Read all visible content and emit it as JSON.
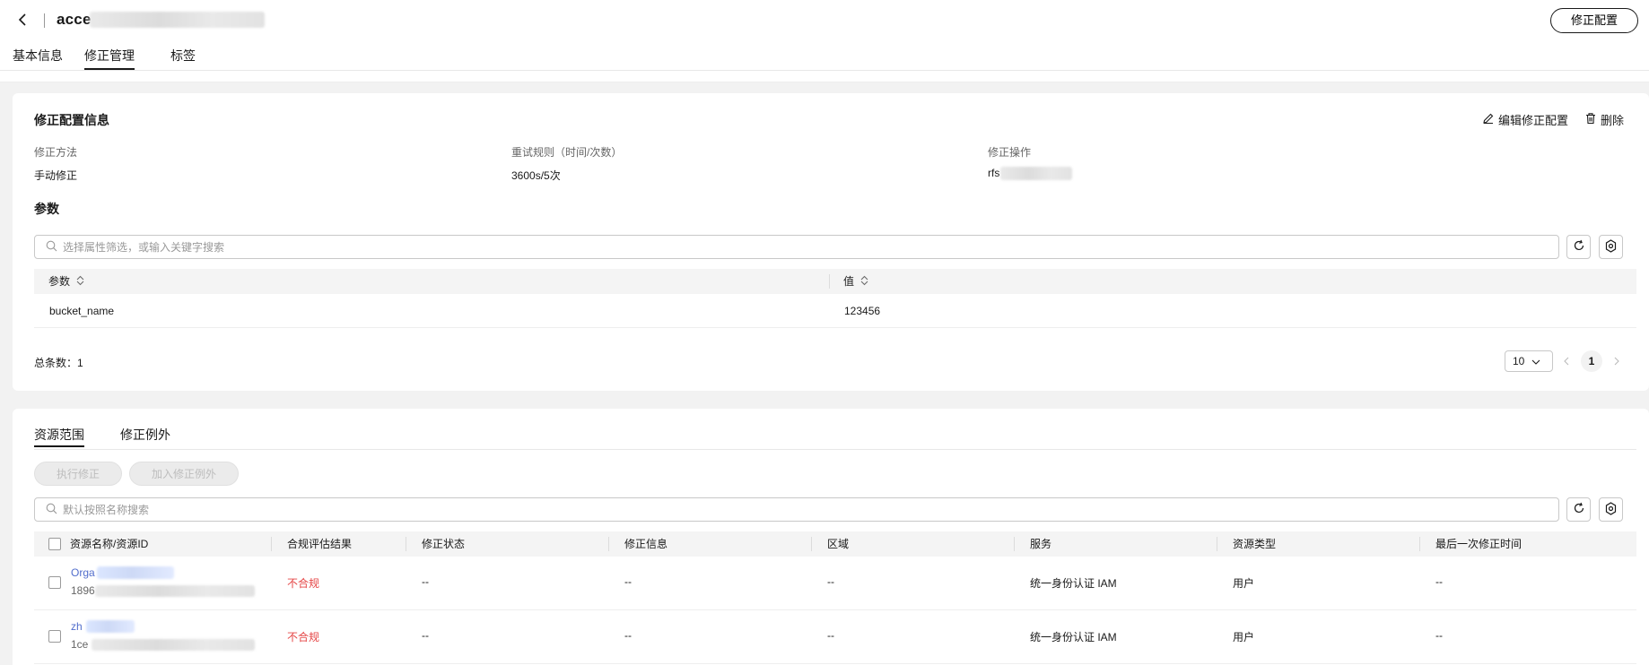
{
  "header": {
    "title": "acce",
    "fix_config_button": "修正配置"
  },
  "tabs": [
    "基本信息",
    "修正管理",
    "标签"
  ],
  "config_info": {
    "title": "修正配置信息",
    "edit_label": "编辑修正配置",
    "delete_label": "删除",
    "fields": [
      {
        "label": "修正方法",
        "value": "手动修正"
      },
      {
        "label": "重试规则（时间/次数）",
        "value": "3600s/5次"
      },
      {
        "label": "修正操作",
        "value": "rfs"
      }
    ]
  },
  "params": {
    "title": "参数",
    "search_placeholder": "选择属性筛选，或输入关键字搜索",
    "columns": [
      "参数",
      "值"
    ],
    "rows": [
      {
        "param": "bucket_name",
        "value": "123456"
      }
    ],
    "total_label": "总条数：1",
    "page_size": "10",
    "current_page": "1"
  },
  "resources": {
    "subtabs": [
      "资源范围",
      "修正例外"
    ],
    "execute_button": "执行修正",
    "add_exception_button": "加入修正例外",
    "search_placeholder": "默认按照名称搜索",
    "columns": [
      "资源名称/资源ID",
      "合规评估结果",
      "修正状态",
      "修正信息",
      "区域",
      "服务",
      "资源类型",
      "最后一次修正时间"
    ],
    "rows": [
      {
        "name": "Orga",
        "id": "1896",
        "compliance": "不合规",
        "status": "--",
        "info": "--",
        "region": "--",
        "service": "统一身份认证 IAM",
        "type": "用户",
        "last_time": "--"
      },
      {
        "name": "zh",
        "id": "1ce",
        "compliance": "不合规",
        "status": "--",
        "info": "--",
        "region": "--",
        "service": "统一身份认证 IAM",
        "type": "用户",
        "last_time": "--"
      }
    ]
  },
  "colors": {
    "link": "#526ecc",
    "non_compliant": "#e54545",
    "page_bg": "#f2f2f2"
  }
}
